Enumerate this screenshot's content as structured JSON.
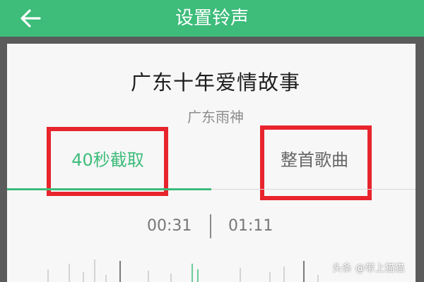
{
  "header": {
    "title": "设置铃声",
    "back_icon": "arrow-left-icon"
  },
  "song": {
    "title": "广东十年爱情故事",
    "artist": "广东雨神"
  },
  "tabs": [
    {
      "label": "40秒截取",
      "active": true
    },
    {
      "label": "整首歌曲",
      "active": false
    }
  ],
  "time": {
    "start": "00:31",
    "end": "01:11"
  },
  "watermark": "头条 @带上猫猫",
  "colors": {
    "accent": "#3dbc7a",
    "highlight": "#e8242c"
  }
}
